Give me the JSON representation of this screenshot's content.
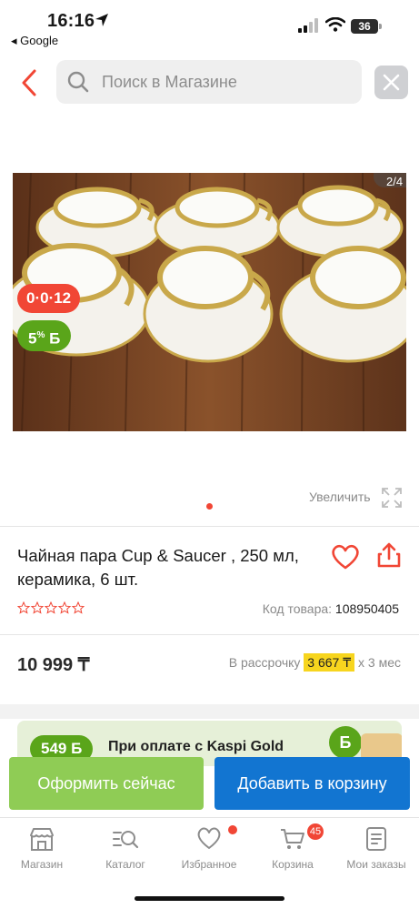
{
  "status_bar": {
    "time": "16:16",
    "back_app": "◂ Google",
    "battery": "36"
  },
  "search": {
    "placeholder": "Поиск в Магазине"
  },
  "gallery": {
    "counter": "2/4",
    "installment_badge": "0·0·12",
    "bonus_percent": "5",
    "bonus_suffix": "%",
    "bonus_currency": "Б",
    "zoom_label": "Увеличить"
  },
  "product": {
    "title": "Чайная пара Cup & Saucer , 250 мл, керамика, 6 шт.",
    "code_label": "Код товара:",
    "code_value": "108950405",
    "price": "10 999 ₸",
    "credit_prefix": "В рассрочку",
    "credit_amount": "3 667 ₸",
    "credit_suffix": "х 3 мес",
    "rating_stars": 0
  },
  "promo": {
    "bonus_pill": "549 Б",
    "text": "При оплате с Kaspi Gold",
    "coin": "Б"
  },
  "actions": {
    "buy_now": "Оформить сейчас",
    "add_to_cart": "Добавить в корзину"
  },
  "tabbar": {
    "items": [
      {
        "label": "Магазин",
        "icon": "store-icon"
      },
      {
        "label": "Каталог",
        "icon": "catalog-search-icon"
      },
      {
        "label": "Избранное",
        "icon": "heart-icon"
      },
      {
        "label": "Корзина",
        "icon": "cart-icon"
      },
      {
        "label": "Мои заказы",
        "icon": "orders-icon"
      }
    ],
    "cart_count": "45"
  },
  "colors": {
    "accent_red": "#f14635",
    "bonus_green": "#5aa51a",
    "buy_green": "#8fcc55",
    "cart_blue": "#1275d1",
    "highlight_yellow": "#f7d51e"
  }
}
